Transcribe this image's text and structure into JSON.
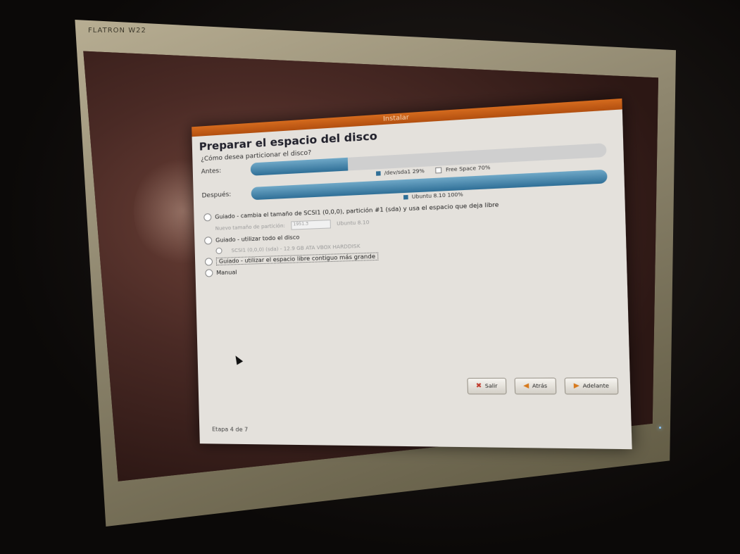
{
  "bezel": {
    "brand": "FLATRON W22"
  },
  "window": {
    "title": "Instalar"
  },
  "page": {
    "heading": "Preparar el espacio del disco",
    "question": "¿Cómo desea particionar el disco?"
  },
  "before": {
    "label": "Antes:",
    "fill_fraction": 0.29,
    "legend": [
      {
        "name": "/dev/sda1",
        "value": "29%",
        "color": "#2f6f97"
      },
      {
        "name": "Free Space",
        "value": "70%",
        "color": "#ffffff"
      }
    ]
  },
  "after": {
    "label": "Después:",
    "fill_fraction": 1.0,
    "legend": [
      {
        "name": "Ubuntu 8.10",
        "value": "100%",
        "color": "#2f6f97"
      }
    ]
  },
  "options": {
    "resize": {
      "label": "Guiado - cambia el tamaño de SCSI1 (0,0,0), partición #1 (sda) y usa el espacio que deja libre",
      "new_size_label": "Nuevo tamaño de partición:",
      "size_value": "1951.3",
      "size_hint": "Ubuntu 8.10"
    },
    "entire": {
      "label": "Guiado - utilizar todo el disco",
      "sub": "SCSI1 (0,0,0) (sda) - 12.9 GB ATA VBOX HARDDISK"
    },
    "largest": {
      "label": "Guiado - utilizar el espacio libre contiguo más grande"
    },
    "manual": {
      "label": "Manual"
    }
  },
  "buttons": {
    "quit": "Salir",
    "back": "Atrás",
    "forward": "Adelante"
  },
  "stage": "Etapa 4 de 7",
  "colors": {
    "titlebar": "#c85d17",
    "bar_fill": "#2f6f97"
  }
}
